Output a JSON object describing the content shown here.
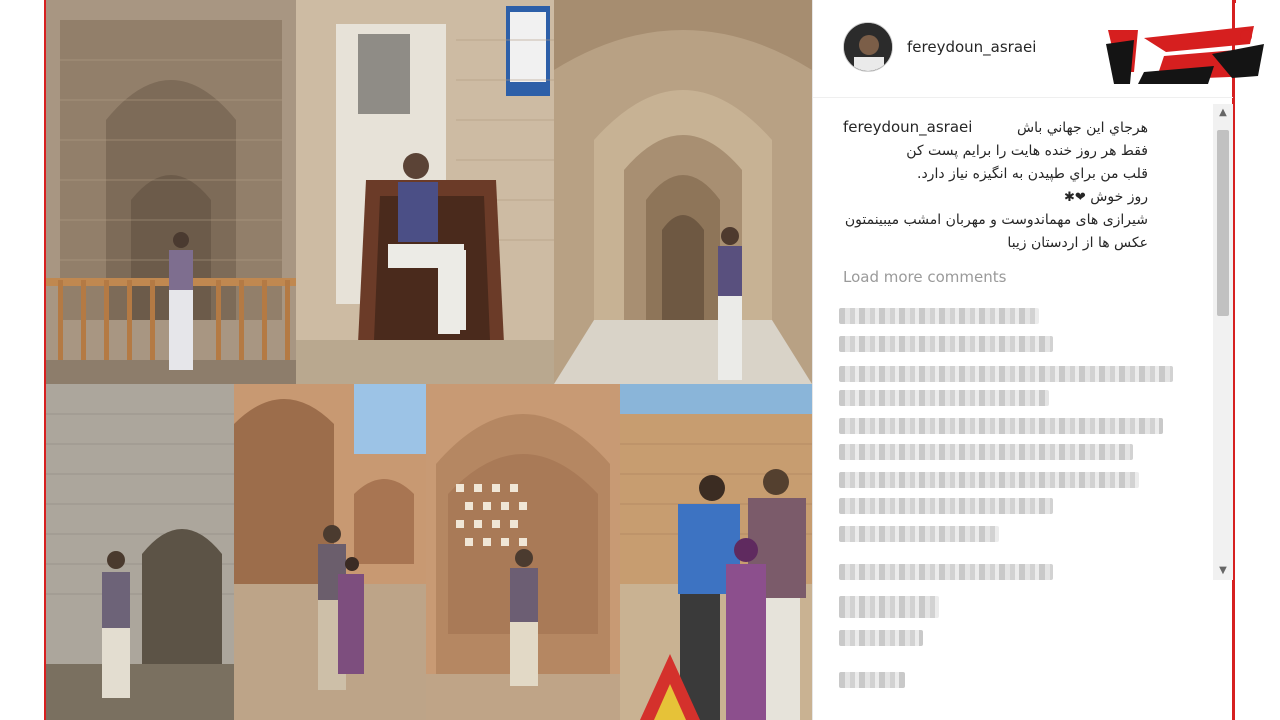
{
  "post": {
    "username": "fereydoun_asraei",
    "caption_user": "fereydoun_asraei",
    "caption_lines": [
      "هرجاي اين جهاني باش",
      "فقط هر روز خنده هايت را برايم پست كن",
      "قلب من براي طپيدن به انگيزه نياز دارد.",
      "روز خوش",
      "شيرازی های مهماندوست و مهربان امشب ميبينمتون",
      "عکس ها از اردستان زيبا"
    ],
    "load_more": "Load more comments"
  },
  "colors": {
    "frame_red": "#d62020",
    "text": "#262626",
    "muted": "#9a9a9a"
  },
  "icons": {
    "scroll_up": "▲",
    "scroll_down": "▼"
  }
}
